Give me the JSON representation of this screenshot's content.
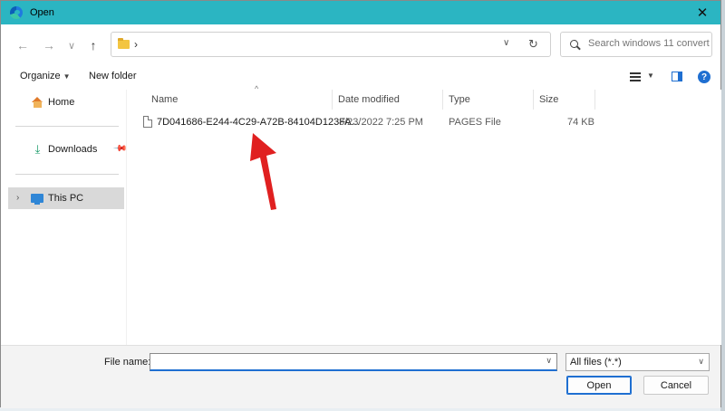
{
  "window": {
    "title": "Open",
    "close_glyph": "✕"
  },
  "nav": {
    "back_glyph": "←",
    "forward_glyph": "→",
    "recent_glyph": "∨",
    "up_glyph": "↑",
    "address_separator": "›",
    "address_dropdown_glyph": "∨",
    "refresh_glyph": "↻"
  },
  "search": {
    "placeholder": "Search windows 11 convert ..."
  },
  "toolbar": {
    "organize_label": "Organize",
    "organize_caret": "▼",
    "new_folder_label": "New folder",
    "view_caret": "▼",
    "help_glyph": "?"
  },
  "sidebar": {
    "items": [
      {
        "label": "Home",
        "icon": "home-icon"
      },
      {
        "label": "Downloads",
        "icon": "download-icon",
        "pinned": true
      },
      {
        "label": "This PC",
        "icon": "computer-icon",
        "selected": true,
        "chevron": "›"
      }
    ]
  },
  "columns": {
    "name": "Name",
    "date_modified": "Date modified",
    "type": "Type",
    "size": "Size",
    "sort_glyph": "^"
  },
  "files": [
    {
      "name": "7D041686-E244-4C29-A72B-84104D123FA...",
      "date_modified": "8/23/2022 7:25 PM",
      "type": "PAGES File",
      "size": "74 KB"
    }
  ],
  "footer": {
    "file_name_label": "File name:",
    "file_name_value": "",
    "file_name_dropdown_glyph": "∨",
    "file_type_value": "All files (*.*)",
    "file_type_dropdown_glyph": "∨",
    "open_label": "Open",
    "cancel_label": "Cancel"
  },
  "annotation": {
    "arrow_color": "#e02020"
  }
}
